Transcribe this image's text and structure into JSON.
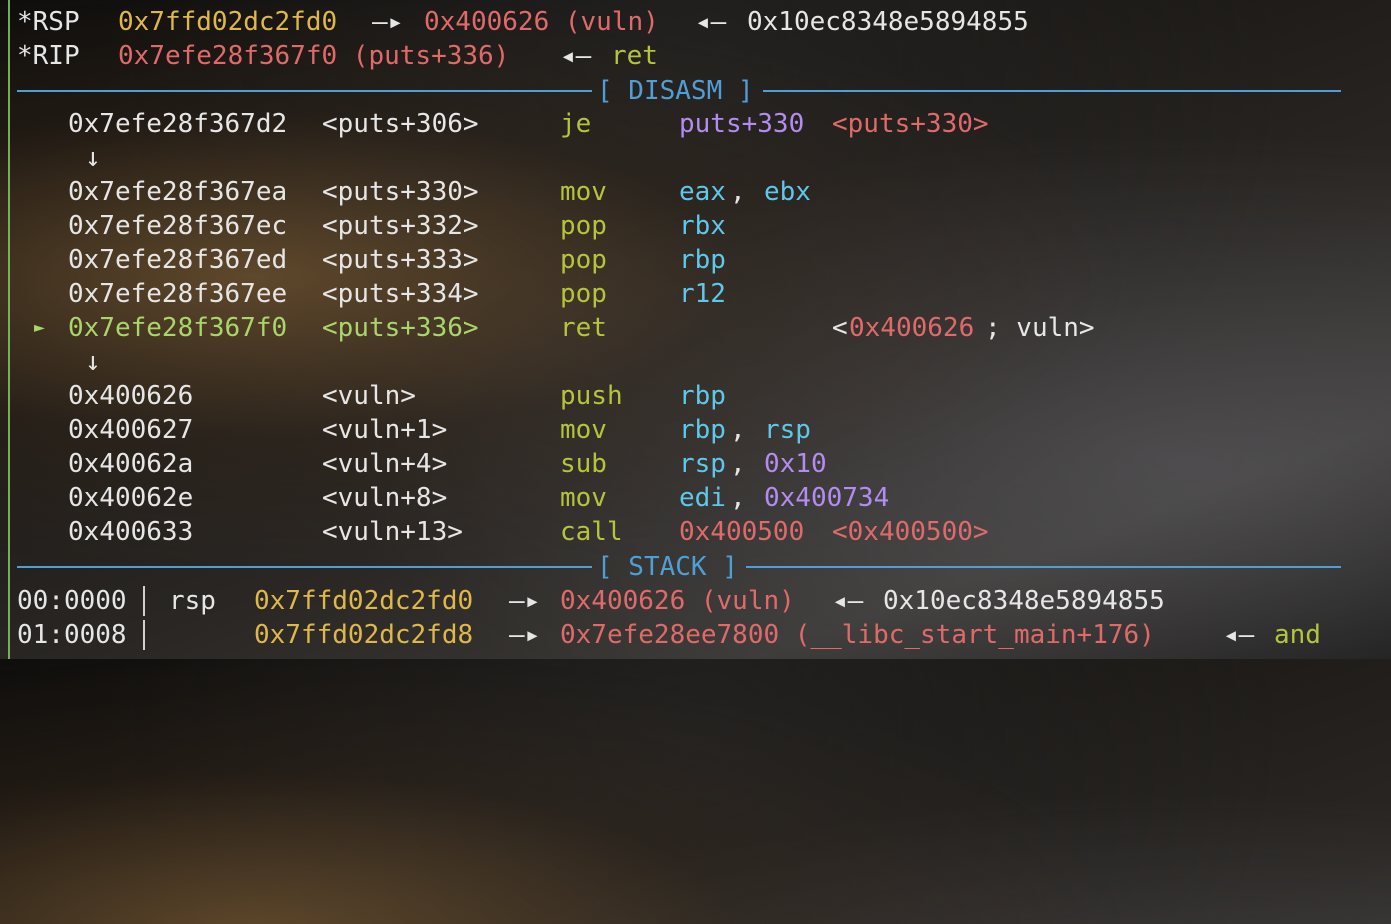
{
  "registers": {
    "rsp": {
      "label": "*RSP",
      "addr": "0x7ffd02dc2fd0",
      "arrow1": "—▸",
      "target": "0x400626 (vuln)",
      "arrow2": "◂—",
      "value": "0x10ec8348e5894855"
    },
    "rip": {
      "label": "*RIP",
      "addr": "0x7efe28f367f0 (puts+336)",
      "arrow": "◂—",
      "value": "ret"
    }
  },
  "disasm": {
    "title": "[ DISASM ]",
    "rows": [
      {
        "marker": "",
        "addr": "0x7efe28f367d2",
        "sym": "<puts+306>",
        "mnem": "je",
        "op1": "puts+330",
        "op2": "<puts+330>"
      },
      {
        "marker": "",
        "addr": "0x7efe28f367ea",
        "sym": "<puts+330>",
        "mnem": "mov",
        "op1": "eax",
        "comma": ",",
        "op2": "ebx"
      },
      {
        "marker": "",
        "addr": "0x7efe28f367ec",
        "sym": "<puts+332>",
        "mnem": "pop",
        "op1": "rbx"
      },
      {
        "marker": "",
        "addr": "0x7efe28f367ed",
        "sym": "<puts+333>",
        "mnem": "pop",
        "op1": "rbp"
      },
      {
        "marker": "",
        "addr": "0x7efe28f367ee",
        "sym": "<puts+334>",
        "mnem": "pop",
        "op1": "r12"
      },
      {
        "marker": "►",
        "addr": "0x7efe28f367f0",
        "sym": "<puts+336>",
        "mnem": "ret",
        "cmt_open": "<",
        "cmt_addr": "0x400626",
        "cmt_rest": "; vuln>"
      },
      {
        "marker": "",
        "addr": "0x400626",
        "sym": "<vuln>",
        "mnem": "push",
        "op1": "rbp"
      },
      {
        "marker": "",
        "addr": "0x400627",
        "sym": "<vuln+1>",
        "mnem": "mov",
        "op1": "rbp",
        "comma": ",",
        "op2": "rsp"
      },
      {
        "marker": "",
        "addr": "0x40062a",
        "sym": "<vuln+4>",
        "mnem": "sub",
        "op1": "rsp",
        "comma": ",",
        "op2": "0x10"
      },
      {
        "marker": "",
        "addr": "0x40062e",
        "sym": "<vuln+8>",
        "mnem": "mov",
        "op1": "edi",
        "comma": ",",
        "op2": "0x400734"
      },
      {
        "marker": "",
        "addr": "0x400633",
        "sym": "<vuln+13>",
        "mnem": "call",
        "op1": "0x400500",
        "op2": "<0x400500>"
      }
    ],
    "jump_arrow": "↓"
  },
  "stack": {
    "title": "[ STACK ]",
    "rows": [
      {
        "index": "00:0000",
        "reg": "rsp",
        "addr": "0x7ffd02dc2fd0",
        "arrow1": "—▸",
        "target": "0x400626 (vuln)",
        "arrow2": "◂—",
        "value": "0x10ec8348e5894855"
      },
      {
        "index": "01:0008",
        "reg": "",
        "addr": "0x7ffd02dc2fd8",
        "arrow1": "—▸",
        "target": "0x7efe28ee7800 (__libc_start_main+176)",
        "arrow2": "◂—",
        "value": "and"
      }
    ]
  },
  "colors": {
    "separator": "#4f9fd6",
    "address": "#e0b84a",
    "code_pointer": "#e06a6a",
    "mnemonic": "#b4c43c",
    "register": "#5ec8ea",
    "immediate": "#b48cf0",
    "current": "#a9d66a"
  }
}
